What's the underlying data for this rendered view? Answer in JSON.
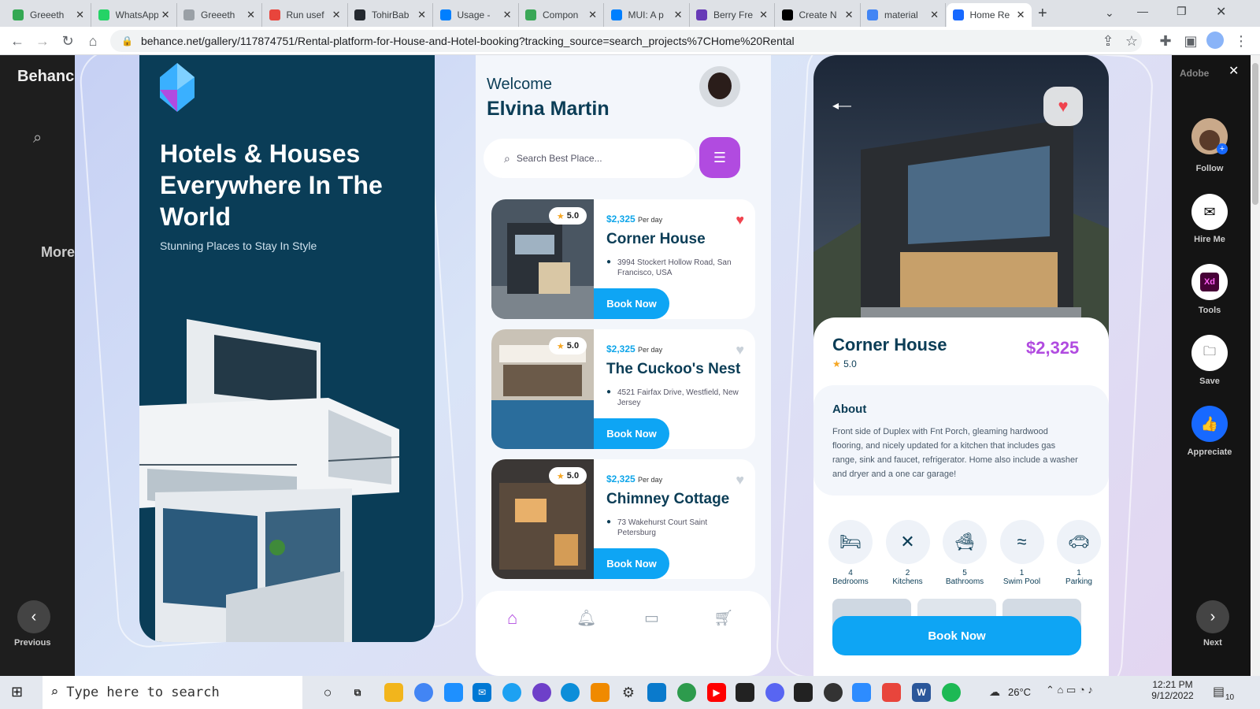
{
  "browser": {
    "tabs": [
      {
        "title": "Greeeth",
        "color": "#34a853"
      },
      {
        "title": "WhatsApp",
        "color": "#25d366"
      },
      {
        "title": "Greeeth",
        "color": "#9aa0a6"
      },
      {
        "title": "Run usef",
        "color": "#e8453c"
      },
      {
        "title": "TohirBab",
        "color": "#24292f"
      },
      {
        "title": "Usage -",
        "color": "#007fff"
      },
      {
        "title": "Compon",
        "color": "#3aa757"
      },
      {
        "title": "MUI: A p",
        "color": "#007fff"
      },
      {
        "title": "Berry Fre",
        "color": "#673ab7"
      },
      {
        "title": "Create N",
        "color": "#000000"
      },
      {
        "title": "material",
        "color": "#4285f4"
      },
      {
        "title": "Home Re",
        "color": "#1769ff"
      }
    ],
    "url": "behance.net/gallery/117874751/Rental-platform-for-House-and-Hotel-booking?tracking_source=search_projects%7CHome%20Rental"
  },
  "behind": {
    "logo": "Behance",
    "more": "More",
    "nav_prev": "Previous",
    "nav_next": "Next",
    "adobe": "Adobe"
  },
  "rail": {
    "follow": "Follow",
    "hire": "Hire Me",
    "tools": "Tools",
    "save": "Save",
    "appreciate": "Appreciate",
    "tools_badge": "Xd"
  },
  "left": {
    "headline": "Hotels & Houses Everywhere In The World",
    "tagline": "Stunning Places to Stay In Style"
  },
  "phone": {
    "welcome": "Welcome",
    "user": "Elvina Martin",
    "search_placeholder": "Search Best Place...",
    "cards": [
      {
        "rating": "5.0",
        "price": "$2,325",
        "per": "Per day",
        "name": "Corner House",
        "address": "3994  Stockert Hollow Road, San Francisco, USA",
        "book": "Book Now",
        "favorite": true
      },
      {
        "rating": "5.0",
        "price": "$2,325",
        "per": "Per day",
        "name": "The Cuckoo's Nest",
        "address": "4521  Fairfax Drive, Westfield, New Jersey",
        "book": "Book Now",
        "favorite": false
      },
      {
        "rating": "5.0",
        "price": "$2,325",
        "per": "Per day",
        "name": "Chimney Cottage",
        "address": "73 Wakehurst Court Saint Petersburg",
        "book": "Book Now",
        "favorite": false
      }
    ]
  },
  "detail": {
    "name": "Corner House",
    "price": "$2,325",
    "rating": "5.0",
    "about_title": "About",
    "about": "Front side of Duplex with Fnt Porch, gleaming hardwood flooring, and nicely updated for a kitchen that includes gas range, sink and faucet, refrigerator. Home also include a washer and dryer and a one car garage!",
    "amenities": [
      {
        "count": "4",
        "label": "Bedrooms",
        "icon": "bed-icon"
      },
      {
        "count": "2",
        "label": "Kitchens",
        "icon": "utensils-icon"
      },
      {
        "count": "5",
        "label": "Bathrooms",
        "icon": "bathtub-icon"
      },
      {
        "count": "1",
        "label": "Swim Pool",
        "icon": "pool-icon"
      },
      {
        "count": "1",
        "label": "Parking",
        "icon": "car-icon"
      }
    ],
    "book": "Book Now"
  },
  "taskbar": {
    "search": "Type here to search",
    "temp": "26°C",
    "time": "12:21 PM",
    "date": "9/12/2022",
    "badge": "10"
  },
  "colors": {
    "brand_blue": "#0ea5f4",
    "dark_teal": "#0a3d57",
    "purple": "#b14be0",
    "heart": "#f0444f"
  }
}
